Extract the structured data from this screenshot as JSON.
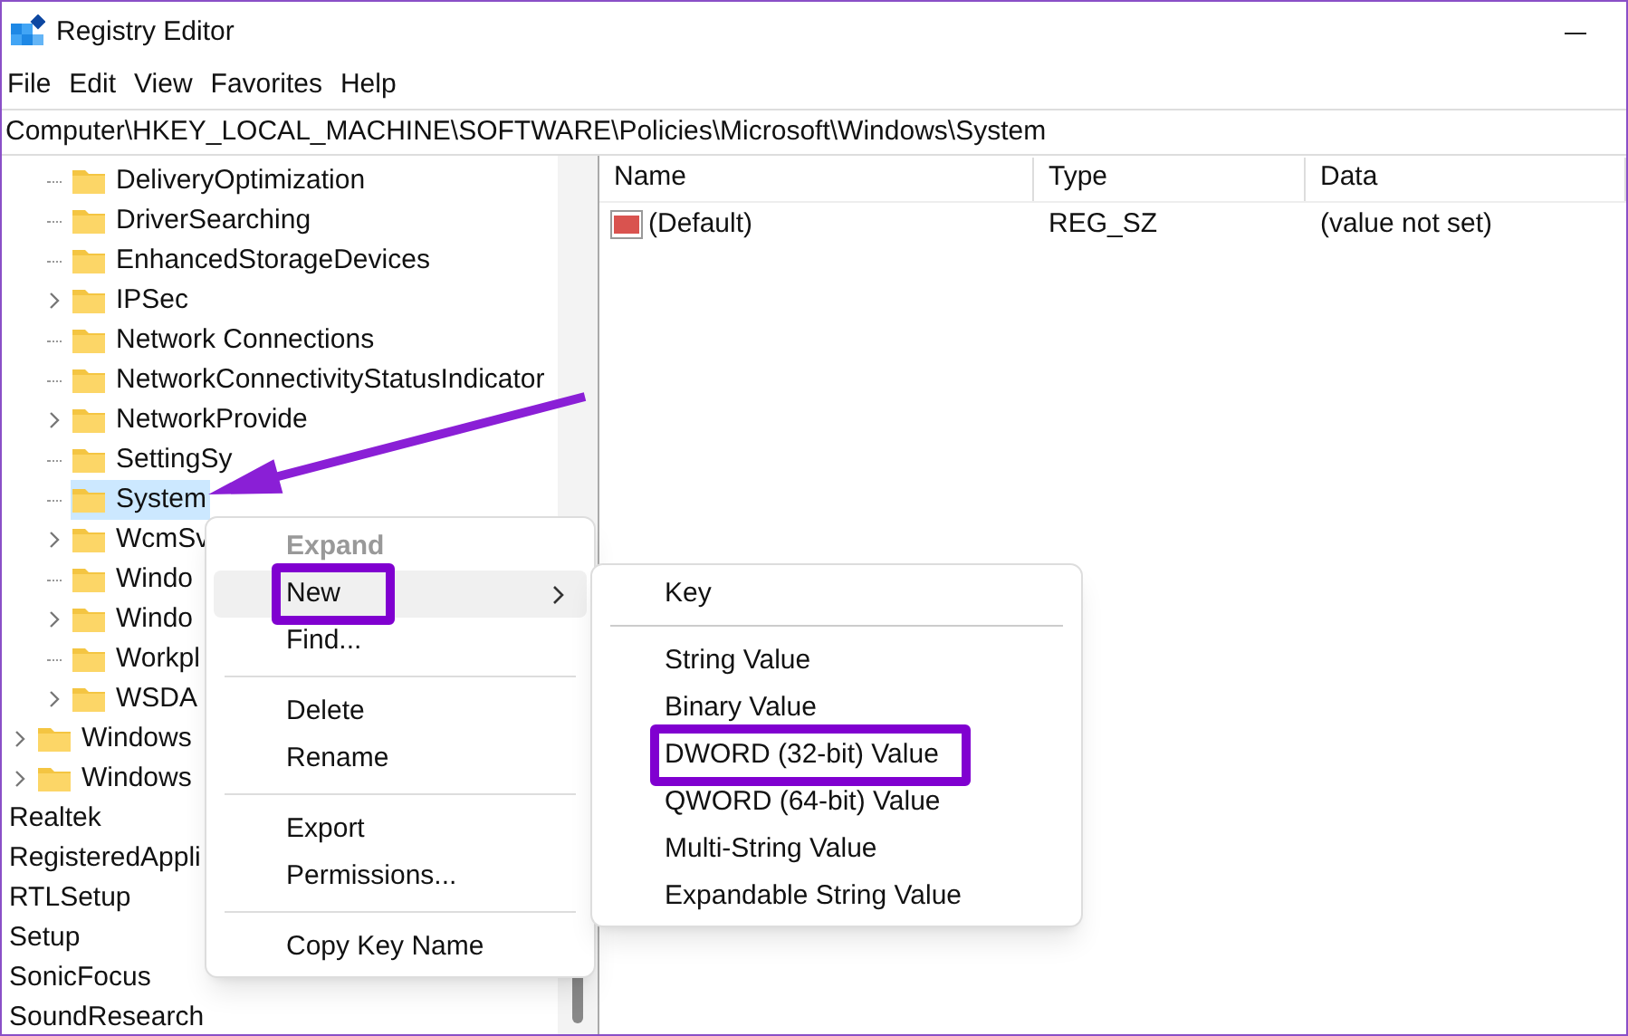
{
  "window": {
    "title": "Registry Editor"
  },
  "menu_bar": [
    "File",
    "Edit",
    "View",
    "Favorites",
    "Help"
  ],
  "address": "Computer\\HKEY_LOCAL_MACHINE\\SOFTWARE\\Policies\\Microsoft\\Windows\\System",
  "tree": [
    {
      "children": [
        {
          "children": [
            {
              "label": "DeliveryOptimization",
              "expandable": false,
              "selected": false
            },
            {
              "label": "DriverSearching",
              "expandable": false,
              "selected": false
            },
            {
              "label": "EnhancedStorageDevices",
              "expandable": false,
              "selected": false
            },
            {
              "label": "IPSec",
              "expandable": true,
              "selected": false
            },
            {
              "label": "Network Connections",
              "expandable": false,
              "selected": false
            },
            {
              "label": "NetworkConnectivityStatusIndicator",
              "expandable": false,
              "selected": false
            },
            {
              "label": "NetworkProvide",
              "expandable": true,
              "selected": false
            },
            {
              "label": "SettingSy",
              "expandable": false,
              "selected": false
            },
            {
              "label": "System",
              "expandable": false,
              "selected": true
            },
            {
              "label": "WcmSv",
              "expandable": true,
              "selected": false
            },
            {
              "label": "Windo",
              "expandable": false,
              "selected": false
            },
            {
              "label": "Windo",
              "expandable": true,
              "selected": false
            },
            {
              "label": "Workpl",
              "expandable": false,
              "selected": false
            },
            {
              "label": "WSDA",
              "expandable": true,
              "selected": false
            }
          ]
        },
        {
          "label": "Windows",
          "expandable": true,
          "selected": false
        },
        {
          "label": "Windows",
          "expandable": true,
          "selected": false
        }
      ]
    },
    {
      "label": "Realtek",
      "selected": false
    },
    {
      "label": "RegisteredAppli",
      "selected": false
    },
    {
      "label": "RTLSetup",
      "selected": false
    },
    {
      "label": "Setup",
      "selected": false
    },
    {
      "label": "SonicFocus",
      "selected": false
    },
    {
      "label": "SoundResearch",
      "selected": false
    }
  ],
  "values": {
    "columns": [
      "Name",
      "Type",
      "Data"
    ],
    "rows": [
      {
        "name": "(Default)",
        "type": "REG_SZ",
        "data": "(value not set)"
      }
    ]
  },
  "context_menu": [
    {
      "kind": "item",
      "label": "Expand",
      "disabled": true,
      "hovered": false,
      "highlighted": false,
      "has_submenu": false
    },
    {
      "kind": "item",
      "label": "New",
      "disabled": false,
      "hovered": true,
      "highlighted": true,
      "has_submenu": true
    },
    {
      "kind": "item",
      "label": "Find...",
      "disabled": false,
      "hovered": false,
      "highlighted": false,
      "has_submenu": false
    },
    {
      "kind": "separator"
    },
    {
      "kind": "item",
      "label": "Delete",
      "disabled": false,
      "hovered": false,
      "highlighted": false,
      "has_submenu": false
    },
    {
      "kind": "item",
      "label": "Rename",
      "disabled": false,
      "hovered": false,
      "highlighted": false,
      "has_submenu": false
    },
    {
      "kind": "separator"
    },
    {
      "kind": "item",
      "label": "Export",
      "disabled": false,
      "hovered": false,
      "highlighted": false,
      "has_submenu": false
    },
    {
      "kind": "item",
      "label": "Permissions...",
      "disabled": false,
      "hovered": false,
      "highlighted": false,
      "has_submenu": false
    },
    {
      "kind": "separator"
    },
    {
      "kind": "item",
      "label": "Copy Key Name",
      "disabled": false,
      "hovered": false,
      "highlighted": false,
      "has_submenu": false
    }
  ],
  "submenu": [
    {
      "kind": "item",
      "label": "Key",
      "highlighted": false
    },
    {
      "kind": "separator"
    },
    {
      "kind": "item",
      "label": "String Value",
      "highlighted": false
    },
    {
      "kind": "item",
      "label": "Binary Value",
      "highlighted": false
    },
    {
      "kind": "item",
      "label": "DWORD (32-bit) Value",
      "highlighted": true
    },
    {
      "kind": "item",
      "label": "QWORD (64-bit) Value",
      "highlighted": false
    },
    {
      "kind": "item",
      "label": "Multi-String Value",
      "highlighted": false
    },
    {
      "kind": "item",
      "label": "Expandable String Value",
      "highlighted": false
    }
  ]
}
